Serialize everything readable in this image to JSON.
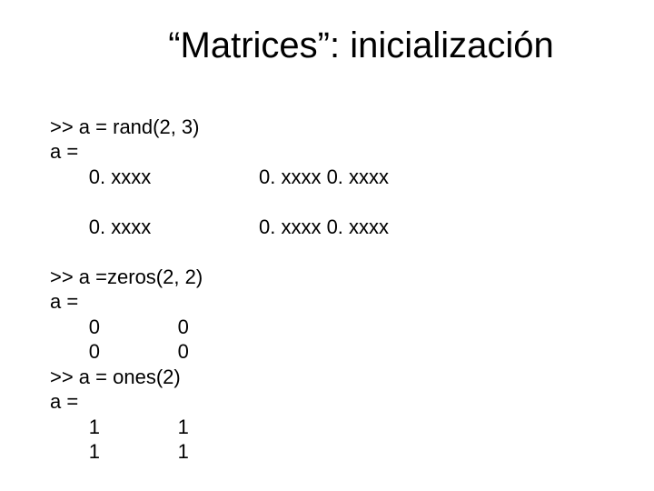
{
  "title": "“Matrices”: inicialización",
  "lines": {
    "l1": ">> a = rand(2, 3)",
    "l2": "a =",
    "l3a": "       0. xxxx",
    "l3b": "0. xxxx 0. xxxx",
    "l4a": "       0. xxxx",
    "l4b": "0. xxxx 0. xxxx",
    "l5": ">> a =zeros(2, 2)",
    "l6": "a =",
    "l7": "       0              0",
    "l8": "       0              0",
    "l9": ">> a = ones(2)",
    "l10": "a =",
    "l11": "       1              1",
    "l12": "       1              1"
  }
}
